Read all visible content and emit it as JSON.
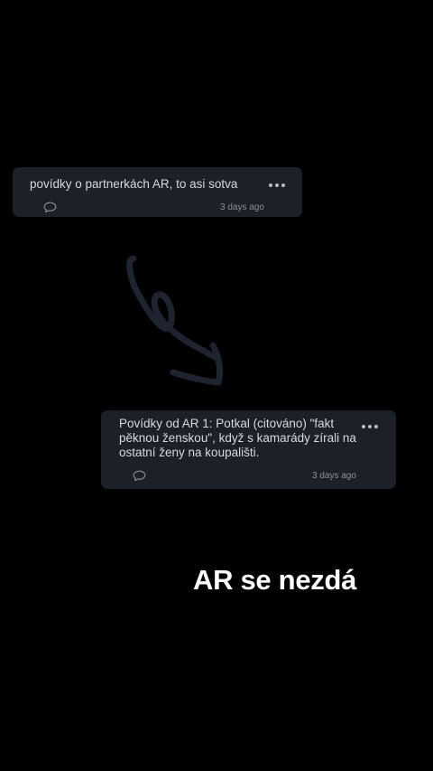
{
  "posts": [
    {
      "text": "povídky o partnerkách AR, to asi sotva",
      "timestamp": "3 days ago"
    },
    {
      "text": "Povídky od AR 1: Potkal (citováno) \"fakt\npěknou ženskou\", když s kamarády zírali na\nostatní ženy na koupališti.",
      "timestamp": "3 days ago"
    }
  ],
  "icons": {
    "more": "more-dots-icon",
    "comment": "comment-bubble-icon",
    "arrow": "hand-drawn-arrow"
  },
  "caption": "AR se nezdá",
  "colors": {
    "background": "#000000",
    "card": "#1c2028",
    "arrow": "#1e2330",
    "caption": "#ffffff"
  }
}
